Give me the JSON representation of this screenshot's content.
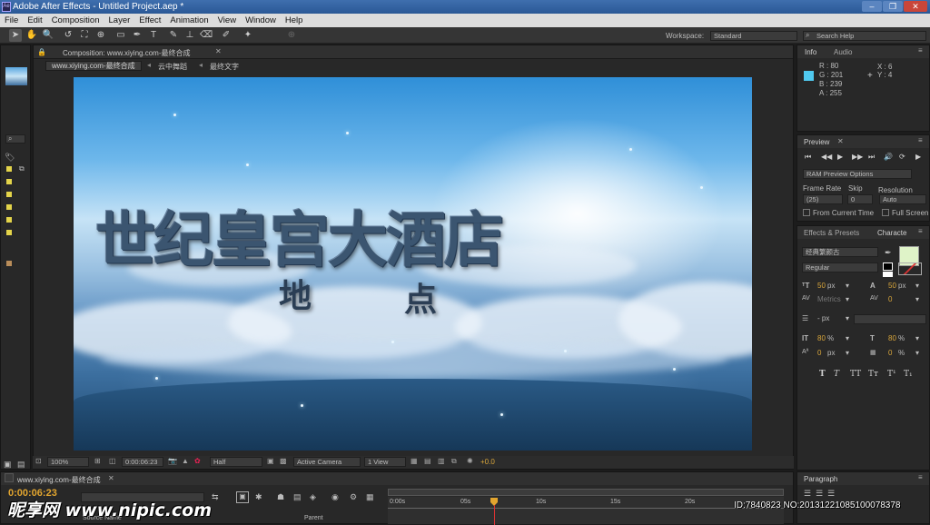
{
  "titlebar": {
    "title": "Adobe After Effects - Untitled Project.aep *",
    "minimize": "–",
    "restore": "❐",
    "close": "✕"
  },
  "menu": [
    "File",
    "Edit",
    "Composition",
    "Layer",
    "Effect",
    "Animation",
    "View",
    "Window",
    "Help"
  ],
  "toolbar": {
    "workspace_label": "Workspace:",
    "workspace_value": "Standard",
    "search_placeholder": "Search Help"
  },
  "composition": {
    "panel_title": "Composition: www.xiying.com-最终合成",
    "tabs": [
      "www.xiying.com-最终合成",
      "云中舞蹈",
      "最终文字"
    ]
  },
  "viewer": {
    "headline": "世纪皇宫大酒店",
    "sub1": "地",
    "sub2": "点"
  },
  "viewer_controls": {
    "zoom": "100%",
    "timecode": "0:00:06:23",
    "resolution": "Half",
    "camera": "Active Camera",
    "views": "1 View",
    "exposure": "+0.0"
  },
  "info": {
    "tab_info": "Info",
    "tab_audio": "Audio",
    "r": "R : 80",
    "g": "G : 201",
    "b": "B : 239",
    "a": "A : 255",
    "x": "X : 6",
    "y": "Y : 4",
    "swatch": "#50c9ef"
  },
  "preview": {
    "title": "Preview",
    "ram_options": "RAM Preview Options",
    "frame_rate_label": "Frame Rate",
    "frame_rate": "(25)",
    "skip_label": "Skip",
    "skip": "0",
    "resolution_label": "Resolution",
    "resolution": "Auto",
    "from_current": "From Current Time",
    "full_screen": "Full Screen"
  },
  "character": {
    "tab_effects": "Effects & Presets",
    "tab_character": "Characte",
    "font_family": "经典繁颜古",
    "font_style": "Regular",
    "font_size": "50",
    "kerning": "Metrics",
    "tracking": "0",
    "leading_unit": "- px",
    "vscale": "80",
    "hscale": "80",
    "baseline": "0",
    "tsume": "0",
    "px": "px",
    "pct": "%",
    "fill_color": "#dff3c8",
    "styles": [
      "T",
      "T",
      "TT",
      "Tт",
      "T¹",
      "T₁"
    ]
  },
  "paragraph": {
    "title": "Paragraph"
  },
  "timeline": {
    "tab": "www.xiying.com-最终合成",
    "timecode": "0:00:06:23",
    "source_name": "Source Name",
    "parent": "Parent",
    "ruler": [
      "0:00s",
      "05s",
      "10s",
      "15s",
      "20s"
    ]
  },
  "watermark": {
    "text": "昵享网 www.nipic.com",
    "id": "ID:7840823 NO:20131221085100078378"
  }
}
